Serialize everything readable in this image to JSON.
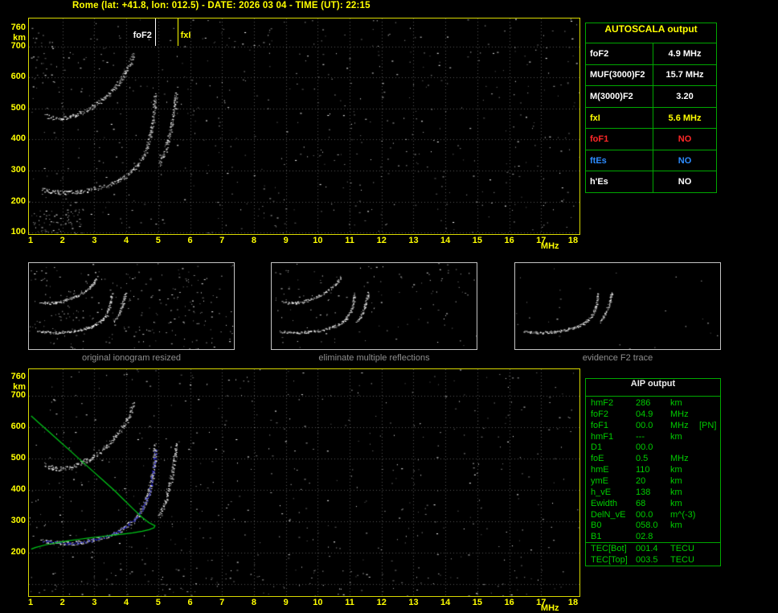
{
  "title": "Rome (lat: +41.8, lon: 012.5) - DATE: 2026 03 04 - TIME (UT): 22:15",
  "colors": {
    "accent_yellow": "#ffff00",
    "panel_green": "#00a800",
    "text_green": "#00cc00",
    "status_red": "#ff2828",
    "status_blue": "#2d8cff",
    "trace_white": "#ffffff",
    "profile_green": "#00c818",
    "restored_blue": "#2323f0"
  },
  "autoscala": {
    "title": "AUTOSCALA output",
    "rows": [
      {
        "label": "foF2",
        "value": "4.9 MHz",
        "color": "#ffffff"
      },
      {
        "label": "MUF(3000)F2",
        "value": "15.7 MHz",
        "color": "#ffffff"
      },
      {
        "label": "M(3000)F2",
        "value": "3.20",
        "color": "#ffffff"
      },
      {
        "label": "fxI",
        "value": "5.6 MHz",
        "color": "#ffff00"
      },
      {
        "label": "foF1",
        "value": "NO",
        "color": "#ff2828"
      },
      {
        "label": "ftEs",
        "value": "NO",
        "color": "#2d8cff"
      },
      {
        "label": "h'Es",
        "value": "NO",
        "color": "#ffffff"
      }
    ]
  },
  "thumbnails": [
    {
      "caption": "original ionogram resized"
    },
    {
      "caption": "eliminate multiple reflections"
    },
    {
      "caption": "evidence F2 trace"
    }
  ],
  "aip": {
    "title": "AIP output",
    "rows": [
      {
        "label": "hmF2",
        "value": "286",
        "unit": "km"
      },
      {
        "label": "foF2",
        "value": "04.9",
        "unit": "MHz"
      },
      {
        "label": "foF1",
        "value": "00.0",
        "unit": "MHz",
        "extra": "[PN]"
      },
      {
        "label": "hmF1",
        "value": "---",
        "unit": "km"
      },
      {
        "label": "D1",
        "value": "00.0",
        "unit": ""
      },
      {
        "label": "foE",
        "value": "0.5",
        "unit": "MHz"
      },
      {
        "label": "hmE",
        "value": "110",
        "unit": "km"
      },
      {
        "label": "ymE",
        "value": "20",
        "unit": "km"
      },
      {
        "label": "h_vE",
        "value": "138",
        "unit": "km"
      },
      {
        "label": "Ewidth",
        "value": "68",
        "unit": "km"
      },
      {
        "label": "DelN_vE",
        "value": "00.0",
        "unit": "m^(-3)"
      },
      {
        "label": "B0",
        "value": "058.0",
        "unit": "km"
      },
      {
        "label": "B1",
        "value": "02.8",
        "unit": ""
      },
      {
        "label": "TEC[Bot]",
        "value": "001.4",
        "unit": "TECU",
        "sep_above": true
      },
      {
        "label": "TEC[Top]",
        "value": "003.5",
        "unit": "TECU"
      }
    ]
  },
  "chart_data": {
    "type": "scatter",
    "title": "Vertical incidence ionogram: virtual height (km) vs sounding frequency (MHz)",
    "xlabel": "MHz",
    "ylabel": "km",
    "annotations": {
      "foF2_MHz": 4.9,
      "fxI_MHz": 5.6,
      "hmF2_km": 286
    },
    "traces": {
      "f2_trace": [
        [
          1.35,
          240
        ],
        [
          1.6,
          234
        ],
        [
          1.9,
          230
        ],
        [
          2.2,
          229
        ],
        [
          2.5,
          232
        ],
        [
          2.8,
          237
        ],
        [
          3.1,
          244
        ],
        [
          3.4,
          253
        ],
        [
          3.7,
          265
        ],
        [
          3.95,
          280
        ],
        [
          4.15,
          297
        ],
        [
          4.35,
          318
        ],
        [
          4.5,
          342
        ],
        [
          4.62,
          370
        ],
        [
          4.72,
          402
        ],
        [
          4.8,
          440
        ],
        [
          4.85,
          478
        ],
        [
          4.88,
          512
        ],
        [
          4.9,
          545
        ]
      ],
      "second_hop": [
        [
          1.45,
          478
        ],
        [
          1.7,
          470
        ],
        [
          1.95,
          468
        ],
        [
          2.2,
          472
        ],
        [
          2.45,
          480
        ],
        [
          2.7,
          492
        ],
        [
          2.95,
          507
        ],
        [
          3.2,
          525
        ],
        [
          3.45,
          547
        ],
        [
          3.65,
          570
        ],
        [
          3.85,
          596
        ],
        [
          4.0,
          622
        ],
        [
          4.12,
          650
        ],
        [
          4.22,
          678
        ]
      ],
      "x_mode_asymptote": [
        [
          5.02,
          318
        ],
        [
          5.15,
          348
        ],
        [
          5.27,
          385
        ],
        [
          5.37,
          425
        ],
        [
          5.45,
          468
        ],
        [
          5.52,
          512
        ],
        [
          5.56,
          550
        ]
      ],
      "restored_f2_blue": [
        [
          1.4,
          238
        ],
        [
          1.8,
          231
        ],
        [
          2.2,
          229
        ],
        [
          2.6,
          233
        ],
        [
          3.0,
          241
        ],
        [
          3.4,
          253
        ],
        [
          3.75,
          267
        ],
        [
          4.05,
          288
        ],
        [
          4.3,
          313
        ],
        [
          4.5,
          342
        ],
        [
          4.65,
          376
        ],
        [
          4.76,
          415
        ],
        [
          4.83,
          458
        ],
        [
          4.88,
          500
        ],
        [
          4.9,
          528
        ]
      ],
      "density_profile_green": [
        [
          1.02,
          636
        ],
        [
          1.25,
          615
        ],
        [
          1.55,
          588
        ],
        [
          1.9,
          556
        ],
        [
          2.25,
          524
        ],
        [
          2.6,
          492
        ],
        [
          2.95,
          460
        ],
        [
          3.3,
          428
        ],
        [
          3.65,
          396
        ],
        [
          3.95,
          366
        ],
        [
          4.25,
          336
        ],
        [
          4.5,
          312
        ],
        [
          4.7,
          296
        ],
        [
          4.85,
          288
        ],
        [
          4.9,
          286
        ],
        [
          4.87,
          279
        ],
        [
          4.72,
          273
        ],
        [
          4.5,
          268
        ],
        [
          4.2,
          263
        ],
        [
          3.9,
          259
        ],
        [
          3.55,
          255
        ],
        [
          3.2,
          251
        ],
        [
          2.85,
          247
        ],
        [
          2.5,
          242
        ],
        [
          2.15,
          237
        ],
        [
          1.8,
          231
        ],
        [
          1.45,
          224
        ],
        [
          1.15,
          216
        ],
        [
          1.02,
          211
        ]
      ]
    },
    "plots": {
      "top": {
        "xlim": [
          1,
          18
        ],
        "ylim": [
          95,
          790
        ],
        "x_ticks": [
          1,
          2,
          3,
          4,
          5,
          6,
          7,
          8,
          9,
          10,
          11,
          12,
          13,
          14,
          15,
          16,
          17,
          18
        ],
        "y_ticks": [
          760,
          700,
          600,
          500,
          400,
          300,
          200,
          100
        ],
        "x_unit": "MHz",
        "y_unit": "km",
        "grid": true,
        "seed": 11,
        "noise": 560,
        "dotScale": 1,
        "series": [
          "f2_trace",
          "second_hop",
          "x_mode_asymptote"
        ],
        "clusters": [
          {
            "f": [
              1.0,
              2.6
            ],
            "km": [
              100,
              175
            ],
            "n": 70
          },
          {
            "f": [
              1.0,
              1.7
            ],
            "km": [
              580,
              730
            ],
            "n": 25
          }
        ],
        "markers": [
          {
            "label": "foF2",
            "freq": 4.9,
            "color": "#ffffff",
            "side": "left"
          },
          {
            "label": "fxI",
            "freq": 5.6,
            "color": "#ffff00",
            "side": "right"
          }
        ]
      },
      "bottom": {
        "xlim": [
          1,
          18
        ],
        "ylim": [
          61,
          785
        ],
        "x_ticks": [
          1,
          2,
          3,
          4,
          5,
          6,
          7,
          8,
          9,
          10,
          11,
          12,
          13,
          14,
          15,
          16,
          17,
          18
        ],
        "y_ticks": [
          760,
          700,
          600,
          500,
          400,
          300,
          200
        ],
        "x_unit": "MHz",
        "y_unit": "km",
        "grid": true,
        "seed": 12,
        "noise": 470,
        "dotScale": 1,
        "series": [
          "f2_trace",
          "second_hop",
          "x_mode_asymptote"
        ],
        "clusters": [
          {
            "f": [
              1.0,
              17.8
            ],
            "km": [
              65,
              160
            ],
            "n": 80
          }
        ],
        "profile": "density_profile_green",
        "overlay": "restored_f2_blue"
      },
      "thumbs": [
        {
          "xlim": [
            1,
            10.5
          ],
          "ylim": [
            95,
            790
          ],
          "grid": false,
          "seed": 21,
          "noise": 260,
          "dotScale": 0.6,
          "series": [
            "f2_trace",
            "second_hop",
            "x_mode_asymptote"
          ]
        },
        {
          "xlim": [
            1,
            10.5
          ],
          "ylim": [
            95,
            790
          ],
          "grid": false,
          "seed": 22,
          "noise": 120,
          "dotScale": 0.6,
          "series": [
            "f2_trace",
            "second_hop",
            "x_mode_asymptote"
          ]
        },
        {
          "xlim": [
            1,
            10.5
          ],
          "ylim": [
            95,
            790
          ],
          "grid": false,
          "seed": 23,
          "noise": 25,
          "dotScale": 0.6,
          "series": [
            "f2_trace",
            "x_mode_asymptote"
          ]
        }
      ]
    }
  }
}
